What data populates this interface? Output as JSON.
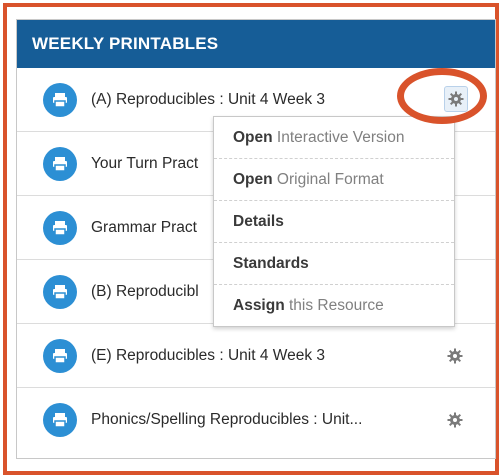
{
  "panel": {
    "title": "WEEKLY PRINTABLES",
    "items": [
      {
        "label": "(A) Reproducibles : Unit 4 Week 3"
      },
      {
        "label": "Your Turn Pract"
      },
      {
        "label": "Grammar Pract"
      },
      {
        "label": "(B) Reproducibl"
      },
      {
        "label": "(E) Reproducibles : Unit 4 Week 3"
      },
      {
        "label": "Phonics/Spelling Reproducibles : Unit..."
      }
    ]
  },
  "menu": {
    "items": [
      {
        "bold": "Open",
        "rest": " Interactive Version"
      },
      {
        "bold": "Open",
        "rest": " Original Format"
      },
      {
        "bold": "Details",
        "rest": ""
      },
      {
        "bold": "Standards",
        "rest": ""
      },
      {
        "bold": "Assign",
        "rest": " this Resource"
      }
    ]
  },
  "colors": {
    "header": "#165d97",
    "icon_circle": "#2c8fd4",
    "highlight": "#d9532b"
  },
  "icons": {
    "row_icon": "printer-icon",
    "action_icon": "gear-icon"
  }
}
